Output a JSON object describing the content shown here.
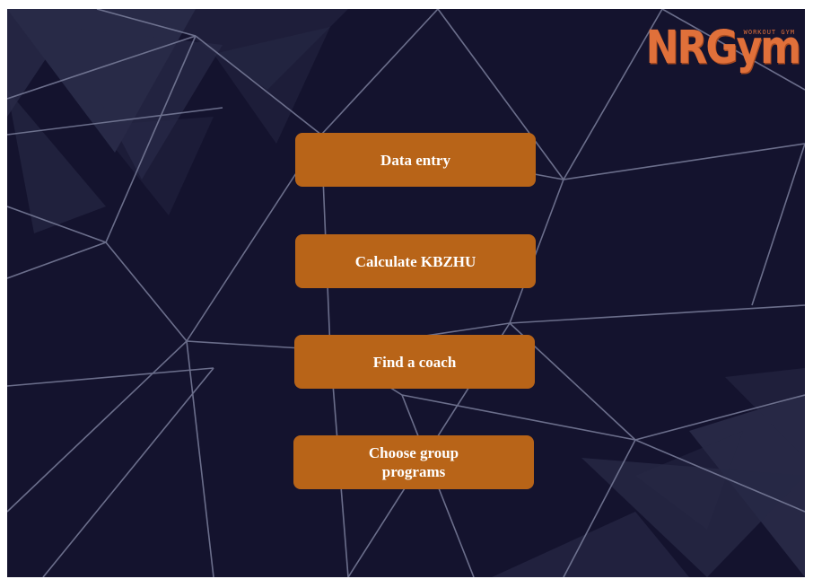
{
  "logo": {
    "main": "NRGym",
    "sub": "WORKOUT GYM"
  },
  "menu": {
    "data_entry": "Data entry",
    "calculate": "Calculate KBZHU",
    "find_coach": "Find a coach",
    "group_programs": "Choose group programs"
  },
  "colors": {
    "background": "#14132e",
    "button": "#b86418",
    "button_text": "#ffffff",
    "logo": "#e0703a"
  }
}
